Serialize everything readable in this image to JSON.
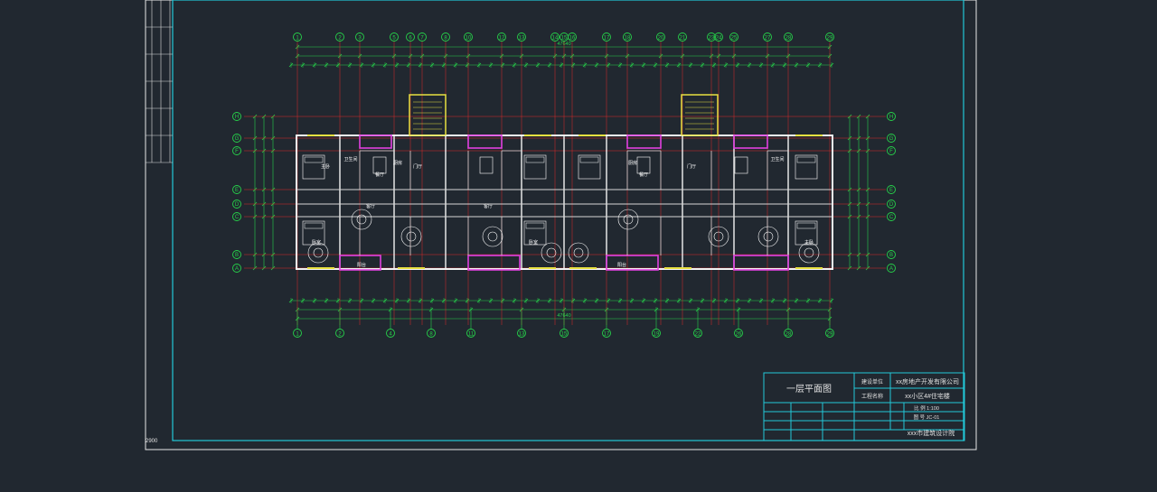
{
  "drawing": {
    "title": "一层平面图",
    "total_dimension": "47640",
    "left_border_text": "2900",
    "colors": {
      "background": "#212830",
      "frame": "#e8e8e8",
      "border_cyan": "#22c8d8",
      "grid_axis": "#e02828",
      "dimension": "#26d24a",
      "wall": "#f2f2f2",
      "partition": "#d6d6d6",
      "balcony": "#e040e0",
      "stair": "#e8e040",
      "furniture": "#ffffff"
    }
  },
  "title_block": {
    "title": "一层平面图",
    "row1_label": "建设单位",
    "row1_value": "xx房地产开发有限公司",
    "row2_label": "工程名称",
    "row2_value": "xx小区4#住宅楼",
    "scale": "比 例 1:100",
    "drawing_no": "图 号 JC-01",
    "designer": "xxx市建筑设计院"
  },
  "axes_top": [
    "1",
    "2",
    "3",
    "5",
    "6",
    "7",
    "8",
    "10",
    "12",
    "13",
    "14",
    "15",
    "16",
    "17",
    "18",
    "20",
    "21",
    "23",
    "24",
    "25",
    "27",
    "28",
    "29"
  ],
  "axes_bottom": [
    "1",
    "2",
    "4",
    "8",
    "11",
    "13",
    "15",
    "17",
    "19",
    "22",
    "26",
    "28",
    "29"
  ],
  "axes_side": [
    "H",
    "G",
    "F",
    "E",
    "D",
    "C",
    "B",
    "A"
  ],
  "room_labels": [
    "卧室",
    "客厅",
    "厨房",
    "餐厅",
    "卫生间",
    "阳台",
    "门厅",
    "主卧"
  ]
}
